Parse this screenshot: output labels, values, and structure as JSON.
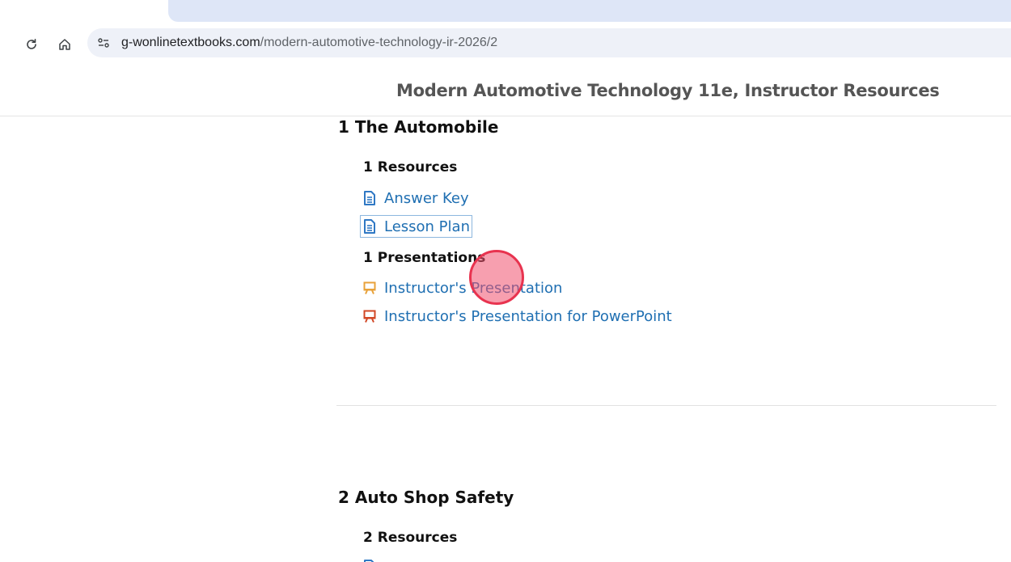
{
  "browser": {
    "url_domain": "g-wonlinetextbooks.com",
    "url_path": "/modern-automotive-technology-ir-2026/2"
  },
  "page": {
    "title": "Modern Automotive Technology 11e, Instructor Resources"
  },
  "chapters": [
    {
      "title": "1 The Automobile",
      "resources_heading": "1 Resources",
      "resources": [
        {
          "label": "Answer Key",
          "icon": "document-icon"
        },
        {
          "label": "Lesson Plan",
          "icon": "document-icon"
        }
      ],
      "presentations_heading": "1 Presentations",
      "presentations": [
        {
          "label": "Instructor's Presentation",
          "icon": "presentation-icon"
        },
        {
          "label": "Instructor's Presentation for PowerPoint",
          "icon": "powerpoint-presentation-icon"
        }
      ]
    },
    {
      "title": "2 Auto Shop Safety",
      "resources_heading": "2 Resources"
    }
  ],
  "colors": {
    "link": "#1f6fb2",
    "document_icon": "#2f78c4",
    "presentation_icon": "#e8a23a",
    "powerpoint_icon": "#d24726",
    "click_marker": "#e8334f"
  }
}
